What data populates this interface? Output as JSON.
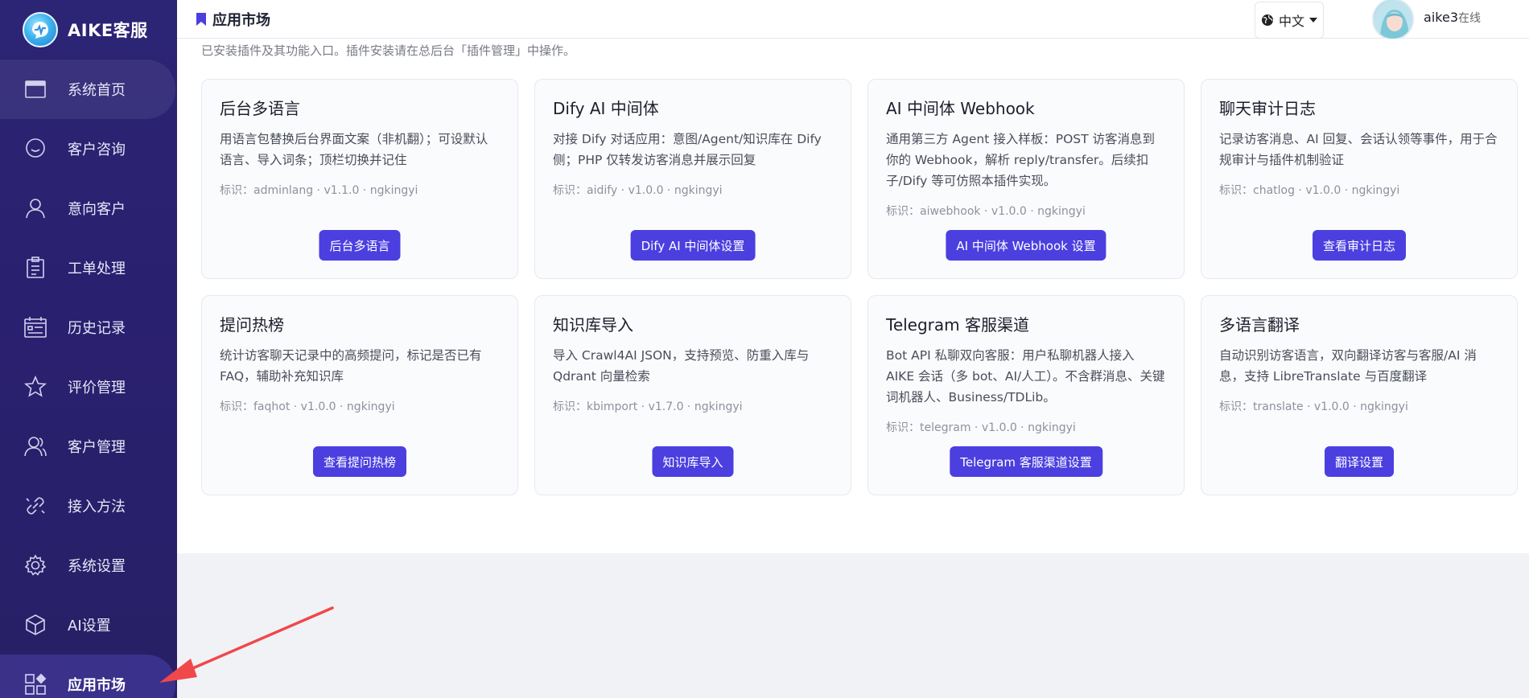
{
  "brand": {
    "name": "AIKE客服"
  },
  "sidebar": {
    "items": [
      {
        "label": "系统首页",
        "icon": "window-icon"
      },
      {
        "label": "客户咨询",
        "icon": "chat-bubble-icon"
      },
      {
        "label": "意向客户",
        "icon": "person-icon"
      },
      {
        "label": "工单处理",
        "icon": "clipboard-icon"
      },
      {
        "label": "历史记录",
        "icon": "calendar-list-icon"
      },
      {
        "label": "评价管理",
        "icon": "star-icon"
      },
      {
        "label": "客户管理",
        "icon": "user-manage-icon"
      },
      {
        "label": "接入方法",
        "icon": "link-icon"
      },
      {
        "label": "系统设置",
        "icon": "gear-icon"
      },
      {
        "label": "AI设置",
        "icon": "cube-icon"
      },
      {
        "label": "应用市场",
        "icon": "apps-grid-icon"
      }
    ],
    "active_index": 10
  },
  "topbar": {
    "title": "应用市场",
    "language": "中文",
    "user": {
      "name": "aike3",
      "status": "在线"
    }
  },
  "main": {
    "intro": "已安装插件及其功能入口。插件安装请在总后台「插件管理」中操作。",
    "plugins": [
      {
        "title": "后台多语言",
        "desc": "用语言包替换后台界面文案（非机翻）；可设默认语言、导入词条；顶栏切换并记住",
        "meta": "标识：adminlang · v1.1.0 · ngkingyi",
        "button": "后台多语言"
      },
      {
        "title": "Dify AI 中间体",
        "desc": "对接 Dify 对话应用：意图/Agent/知识库在 Dify 侧；PHP 仅转发访客消息并展示回复",
        "meta": "标识：aidify · v1.0.0 · ngkingyi",
        "button": "Dify AI 中间体设置"
      },
      {
        "title": "AI 中间体 Webhook",
        "desc": "通用第三方 Agent 接入样板：POST 访客消息到你的 Webhook，解析 reply/transfer。后续扣子/Dify 等可仿照本插件实现。",
        "meta": "标识：aiwebhook · v1.0.0 · ngkingyi",
        "button": "AI 中间体 Webhook 设置"
      },
      {
        "title": "聊天审计日志",
        "desc": "记录访客消息、AI 回复、会话认领等事件，用于合规审计与插件机制验证",
        "meta": "标识：chatlog · v1.0.0 · ngkingyi",
        "button": "查看审计日志"
      },
      {
        "title": "提问热榜",
        "desc": "统计访客聊天记录中的高频提问，标记是否已有 FAQ，辅助补充知识库",
        "meta": "标识：faqhot · v1.0.0 · ngkingyi",
        "button": "查看提问热榜"
      },
      {
        "title": "知识库导入",
        "desc": "导入 Crawl4AI JSON，支持预览、防重入库与 Qdrant 向量检索",
        "meta": "标识：kbimport · v1.7.0 · ngkingyi",
        "button": "知识库导入"
      },
      {
        "title": "Telegram 客服渠道",
        "desc": "Bot API 私聊双向客服：用户私聊机器人接入 AIKE 会话（多 bot、AI/人工）。不含群消息、关键词机器人、Business/TDLib。",
        "meta": "标识：telegram · v1.0.0 · ngkingyi",
        "button": "Telegram 客服渠道设置"
      },
      {
        "title": "多语言翻译",
        "desc": "自动识别访客语言，双向翻译访客与客服/AI 消息，支持 LibreTranslate 与百度翻译",
        "meta": "标识：translate · v1.0.0 · ngkingyi",
        "button": "翻译设置"
      }
    ]
  },
  "colors": {
    "sidebar_bg": "#2a2070",
    "accent": "#4b3fe0",
    "annotation_arrow": "#f0484a"
  }
}
